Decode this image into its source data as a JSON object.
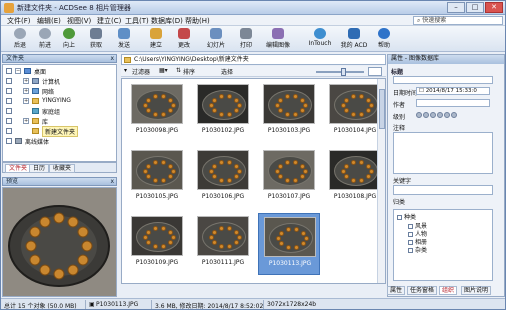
{
  "window": {
    "title": "新建文件夹 - ACDSee 8 相片管理器",
    "min_label": "–",
    "max_label": "□",
    "close_label": "✕"
  },
  "menu": {
    "items": [
      "文件(F)",
      "编辑(E)",
      "视图(V)",
      "建立(C)",
      "工具(T)",
      "数据库(D)",
      "帮助(H)"
    ],
    "quick_search": "快速搜索"
  },
  "toolbar": {
    "buttons": [
      "后退",
      "前进",
      "向上",
      "获取",
      "发送",
      "建立",
      "更改",
      "幻灯片",
      "打印",
      "编辑图像",
      "InTouch",
      "我的 ACD",
      "帮助"
    ]
  },
  "folders_pane": {
    "title": "文件夹",
    "close_label": "x",
    "tree": [
      "桌面",
      "计算机",
      "网络",
      "YINGYING",
      "家庭组",
      "库",
      "新建文件夹",
      "离线媒体"
    ],
    "selected": "新建文件夹",
    "tabs": [
      "文件夹",
      "日历",
      "收藏夹"
    ],
    "active_tab": "文件夹"
  },
  "preview_pane": {
    "title": "预览"
  },
  "browser": {
    "path": "C:\\Users\\YINGYING\\Desktop\\新建文件夹",
    "filter_label": "过滤器",
    "sort_label": "排序",
    "select_label": "选择",
    "files": [
      "P1030098.JPG",
      "P1030102.JPG",
      "P1030103.JPG",
      "P1030104.JPG",
      "P1030105.JPG",
      "P1030106.JPG",
      "P1030107.JPG",
      "P1030108.JPG",
      "P1030109.JPG",
      "P1030111.JPG",
      "P1030113.JPG"
    ],
    "selected_file": "P1030113.JPG"
  },
  "properties": {
    "title": "属性 - 图像数据库",
    "section_org": "标题",
    "date_label": "日期时间",
    "date_value": "2014/8/17 15:33:0",
    "author_label": "作者",
    "rating_label": "级别",
    "notes_label": "注释",
    "keywords_label": "关键字",
    "categories_label": "归类",
    "categories_root": "种类",
    "categories": [
      "风景",
      "人物",
      "相册",
      "杂类"
    ],
    "tabs": [
      "属性",
      "任务窗格",
      "组织",
      "图片说明"
    ],
    "active_tab": "组织"
  },
  "status": {
    "total": "总计 15 个对象 (50.0 MB)",
    "file": "P1030113.JPG",
    "info": "3.6 MB, 修改日期: 2014/8/17 8:52:02",
    "dims": "3072x1728x24b"
  },
  "colors": {
    "title_gradient": "#b9cde8",
    "selection": "#6a99d8",
    "accent_tab": "#b5202a"
  }
}
